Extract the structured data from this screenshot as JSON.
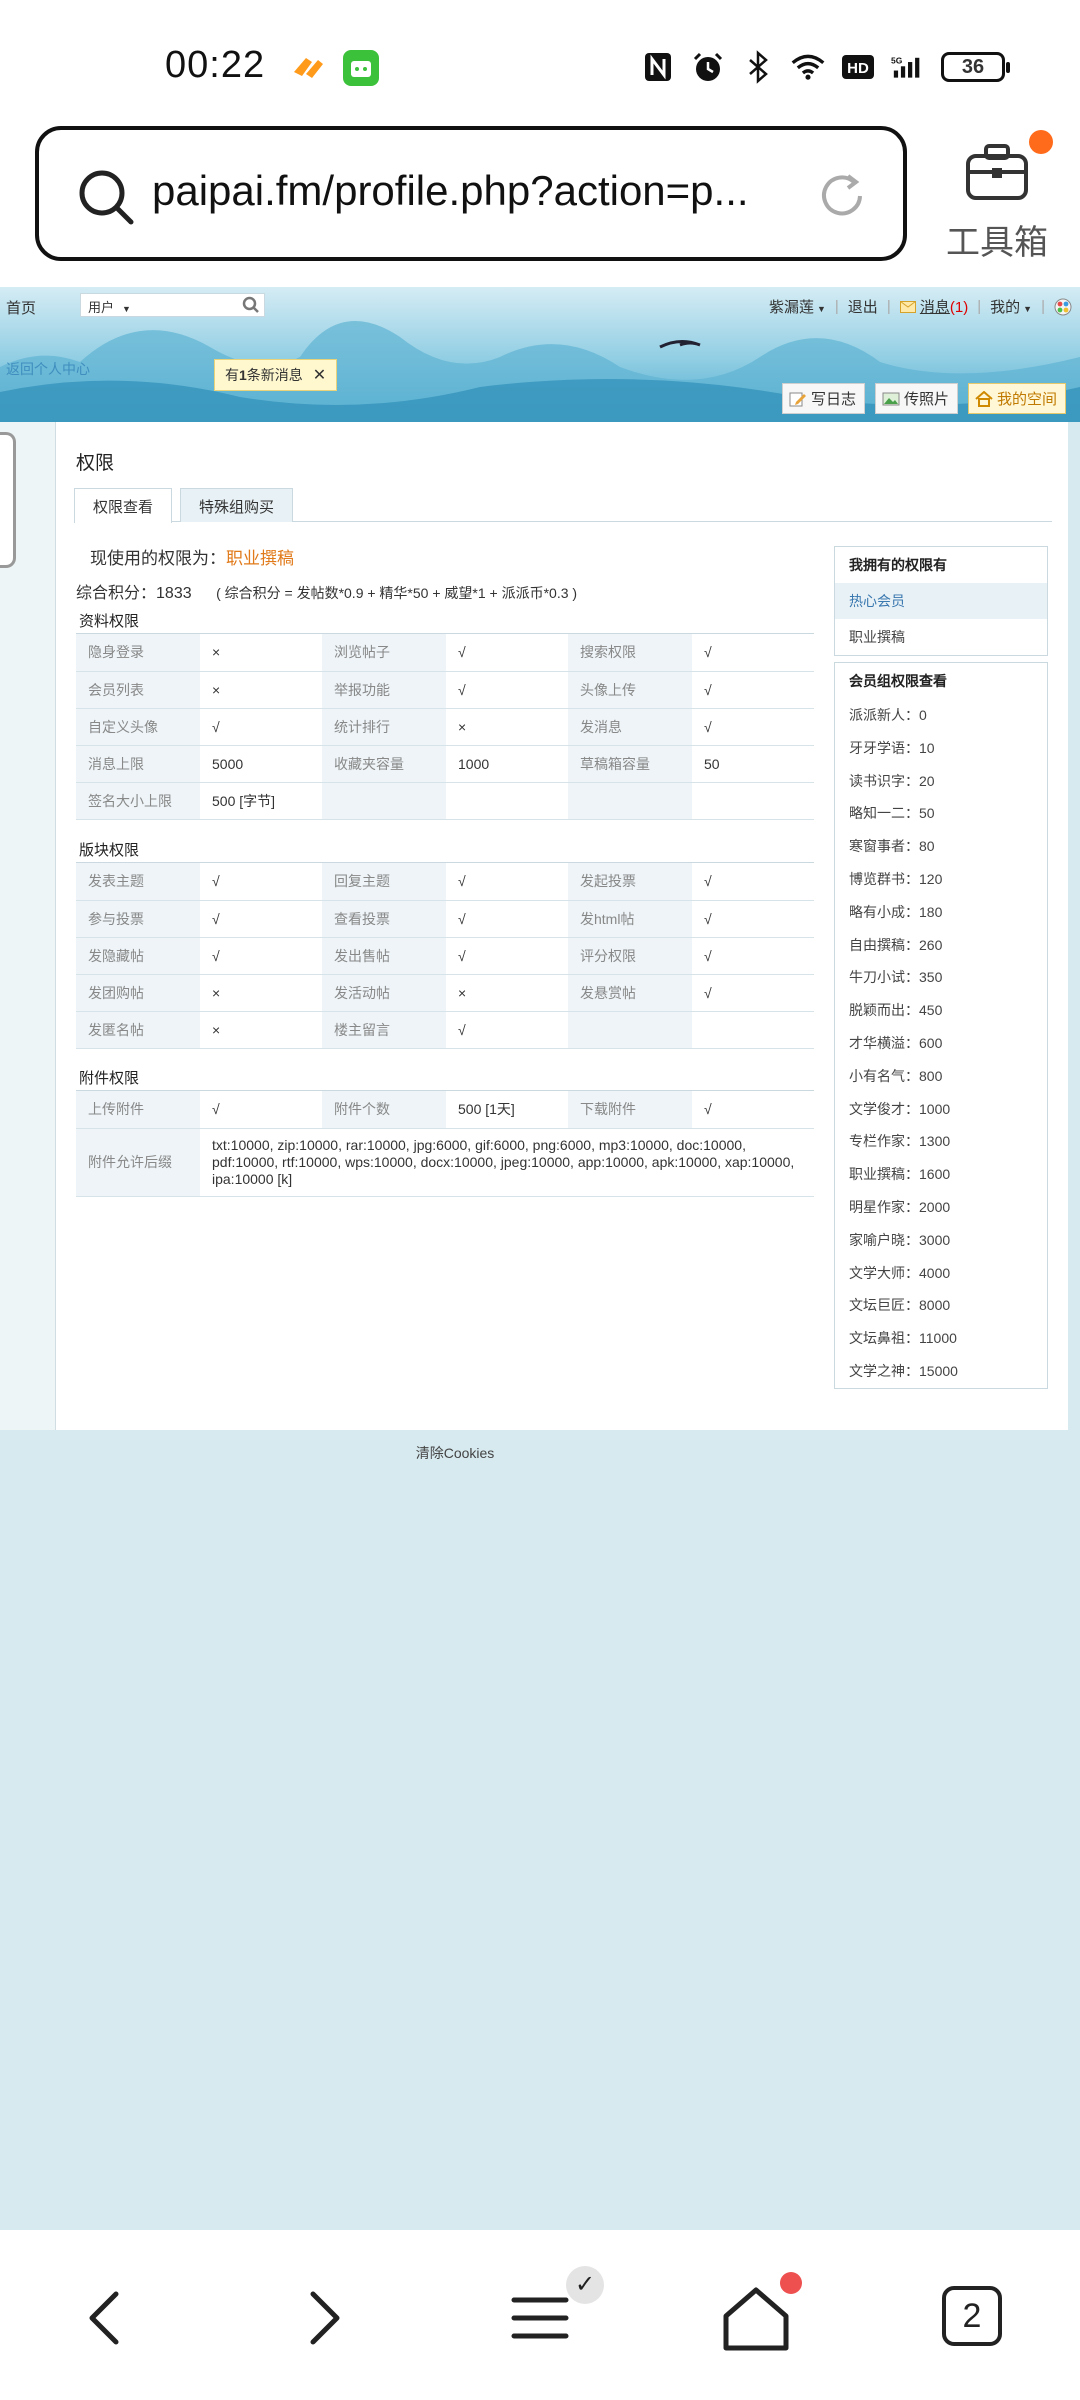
{
  "status": {
    "time": "00:22",
    "battery": "36",
    "icons": [
      "nfc-icon",
      "alarm-icon",
      "bluetooth-icon",
      "wifi-icon",
      "hd-icon",
      "signal-5g-icon",
      "battery-icon"
    ]
  },
  "browser": {
    "url": "paipai.fm/profile.php?action=p...",
    "toolbox_label": "工具箱",
    "tab_count": "2"
  },
  "site_nav": {
    "home": "首页",
    "user_select": "用户",
    "username": "紫漏莲",
    "logout": "退出",
    "messages_label": "消息",
    "messages_count": "(1)",
    "mine": "我的",
    "back_center": "返回个人中心",
    "notice_prefix": "有",
    "notice_count": "1",
    "notice_suffix": "条新消息",
    "write_log": "写日志",
    "upload_photo": "传照片",
    "my_space": "我的空间"
  },
  "page": {
    "title": "权限",
    "tabs": [
      "权限查看",
      "特殊组购买"
    ],
    "current_label": "现使用的权限为：",
    "current_level": "职业撰稿",
    "score_label": "综合积分：",
    "score_value": "1833",
    "score_formula": "( 综合积分 = 发帖数*0.9 + 精华*50 + 威望*1 + 派派币*0.3 )"
  },
  "sections": [
    {
      "title": "资料权限",
      "rows": [
        [
          [
            "隐身登录",
            "×"
          ],
          [
            "浏览帖子",
            "√"
          ],
          [
            "搜索权限",
            "√"
          ]
        ],
        [
          [
            "会员列表",
            "×"
          ],
          [
            "举报功能",
            "√"
          ],
          [
            "头像上传",
            "√"
          ]
        ],
        [
          [
            "自定义头像",
            "√"
          ],
          [
            "统计排行",
            "×"
          ],
          [
            "发消息",
            "√"
          ]
        ],
        [
          [
            "消息上限",
            "5000"
          ],
          [
            "收藏夹容量",
            "1000"
          ],
          [
            "草稿箱容量",
            "50"
          ]
        ],
        [
          [
            "签名大小上限",
            "500 [字节]"
          ],
          [
            "",
            ""
          ],
          [
            "",
            ""
          ]
        ]
      ]
    },
    {
      "title": "版块权限",
      "rows": [
        [
          [
            "发表主题",
            "√"
          ],
          [
            "回复主题",
            "√"
          ],
          [
            "发起投票",
            "√"
          ]
        ],
        [
          [
            "参与投票",
            "√"
          ],
          [
            "查看投票",
            "√"
          ],
          [
            "发html帖",
            "√"
          ]
        ],
        [
          [
            "发隐藏帖",
            "√"
          ],
          [
            "发出售帖",
            "√"
          ],
          [
            "评分权限",
            "√"
          ]
        ],
        [
          [
            "发团购帖",
            "×"
          ],
          [
            "发活动帖",
            "×"
          ],
          [
            "发悬赏帖",
            "√"
          ]
        ],
        [
          [
            "发匿名帖",
            "×"
          ],
          [
            "楼主留言",
            "√"
          ],
          [
            "",
            ""
          ]
        ]
      ]
    },
    {
      "title": "附件权限",
      "rows": [
        [
          [
            "上传附件",
            "√"
          ],
          [
            "附件个数",
            "500 [1天]"
          ],
          [
            "下载附件",
            "√"
          ]
        ]
      ],
      "ext_label": "附件允许后缀",
      "ext_value": "txt:10000, zip:10000, rar:10000, jpg:6000, gif:6000, png:6000, mp3:10000, doc:10000, pdf:10000, rtf:10000, wps:10000, docx:10000, jpeg:10000, app:10000, apk:10000, xap:10000, ipa:10000 [k]"
    }
  ],
  "sidebar": {
    "owned_title": "我拥有的权限有",
    "owned": [
      "热心会员",
      "职业撰稿"
    ],
    "groups_title": "会员组权限查看",
    "groups": [
      "派派新人：0",
      "牙牙学语：10",
      "读书识字：20",
      "略知一二：50",
      "寒窗事者：80",
      "博览群书：120",
      "略有小成：180",
      "自由撰稿：260",
      "牛刀小试：350",
      "脱颖而出：450",
      "才华横溢：600",
      "小有名气：800",
      "文学俊才：1000",
      "专栏作家：1300",
      "职业撰稿：1600",
      "明星作家：2000",
      "家喻户晓：3000",
      "文学大师：4000",
      "文坛巨匠：8000",
      "文坛鼻祖：11000",
      "文学之神：15000"
    ]
  },
  "footer": {
    "clear_cookies": "清除Cookies"
  },
  "colors": {
    "ok": "#1e8a1e",
    "no": "#d93030",
    "accent": "#e07a1a",
    "page_bg": "#d7eaef"
  }
}
